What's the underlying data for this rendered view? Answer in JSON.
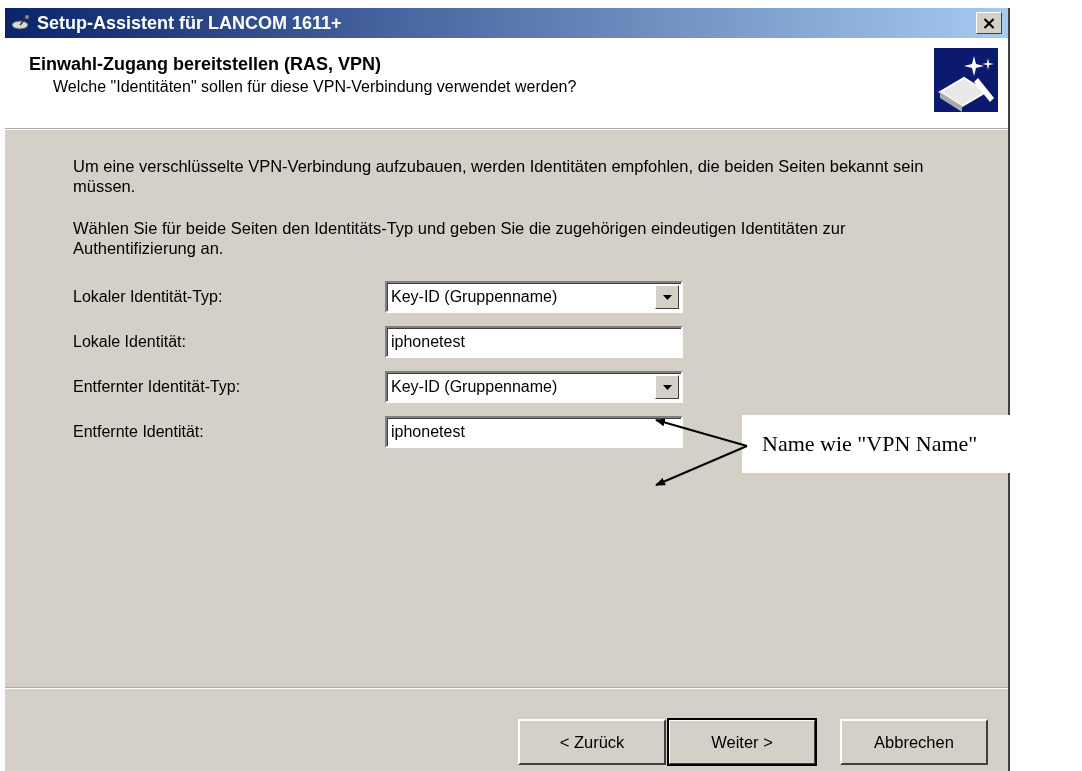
{
  "window": {
    "title": "Setup-Assistent für LANCOM 1611+",
    "close": "×"
  },
  "header": {
    "title": "Einwahl-Zugang bereitstellen (RAS, VPN)",
    "subtitle": "Welche \"Identitäten\" sollen für diese VPN-Verbindung verwendet werden?"
  },
  "paragraphs": [
    "Um eine verschlüsselte VPN-Verbindung aufzubauen, werden Identitäten empfohlen, die beiden Seiten bekannt sein müssen.",
    "Wählen Sie für beide Seiten den Identitäts-Typ und geben Sie die zugehörigen eindeutigen Identitäten zur Authentifizierung an."
  ],
  "fields": [
    {
      "label": "Lokaler Identität-Typ:",
      "kind": "select",
      "value": "Key-ID (Gruppenname)"
    },
    {
      "label": "Lokale Identität:",
      "kind": "text",
      "value": "iphonetest"
    },
    {
      "label": "Entfernter Identität-Typ:",
      "kind": "select",
      "value": "Key-ID (Gruppenname)"
    },
    {
      "label": "Entfernte Identität:",
      "kind": "text",
      "value": "iphonetest"
    }
  ],
  "buttons": [
    {
      "label": "< Zurück",
      "default": false
    },
    {
      "label": "Weiter >",
      "default": true
    },
    {
      "label": "Abbrechen",
      "default": false
    }
  ],
  "annotation": {
    "text": "Name wie \"VPN Name\""
  }
}
